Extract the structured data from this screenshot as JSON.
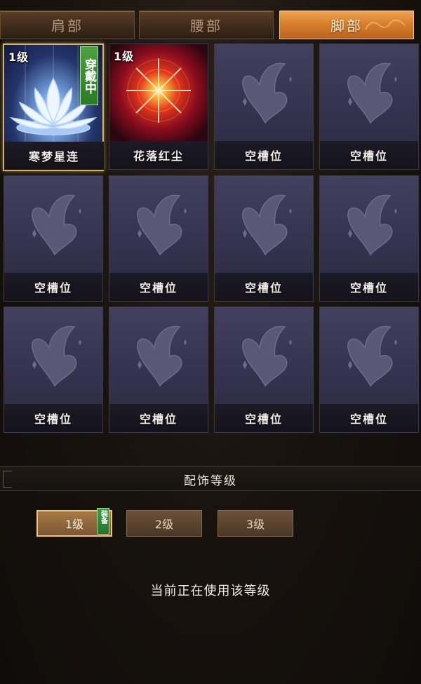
{
  "tabs": [
    {
      "label": "肩部",
      "active": false
    },
    {
      "label": "腰部",
      "active": false
    },
    {
      "label": "脚部",
      "active": true
    }
  ],
  "slots": [
    {
      "name": "寒梦星连",
      "level": "1级",
      "badge": "穿戴中",
      "art": "lotus-icon",
      "selected": true
    },
    {
      "name": "花落红尘",
      "level": "1级",
      "badge": "",
      "art": "red-burst-icon",
      "selected": false
    },
    {
      "name": "空槽位",
      "art": "butterfly-icon"
    },
    {
      "name": "空槽位",
      "art": "butterfly-icon"
    },
    {
      "name": "空槽位",
      "art": "butterfly-icon"
    },
    {
      "name": "空槽位",
      "art": "butterfly-icon"
    },
    {
      "name": "空槽位",
      "art": "butterfly-icon"
    },
    {
      "name": "空槽位",
      "art": "butterfly-icon"
    },
    {
      "name": "空槽位",
      "art": "butterfly-icon"
    },
    {
      "name": "空槽位",
      "art": "butterfly-icon"
    },
    {
      "name": "空槽位",
      "art": "butterfly-icon"
    },
    {
      "name": "空槽位",
      "art": "butterfly-icon"
    }
  ],
  "level_section": {
    "title": "配饰等级",
    "buttons": [
      {
        "label": "1级",
        "active": true,
        "badge": "装备"
      },
      {
        "label": "2级",
        "active": false
      },
      {
        "label": "3级",
        "active": false
      }
    ],
    "status": "当前正在使用该等级"
  },
  "colors": {
    "tab_active": "#d9802e",
    "badge_green": "#2c7a25",
    "slot_bg": "#34324d",
    "selected_border": "#d6b36a"
  }
}
